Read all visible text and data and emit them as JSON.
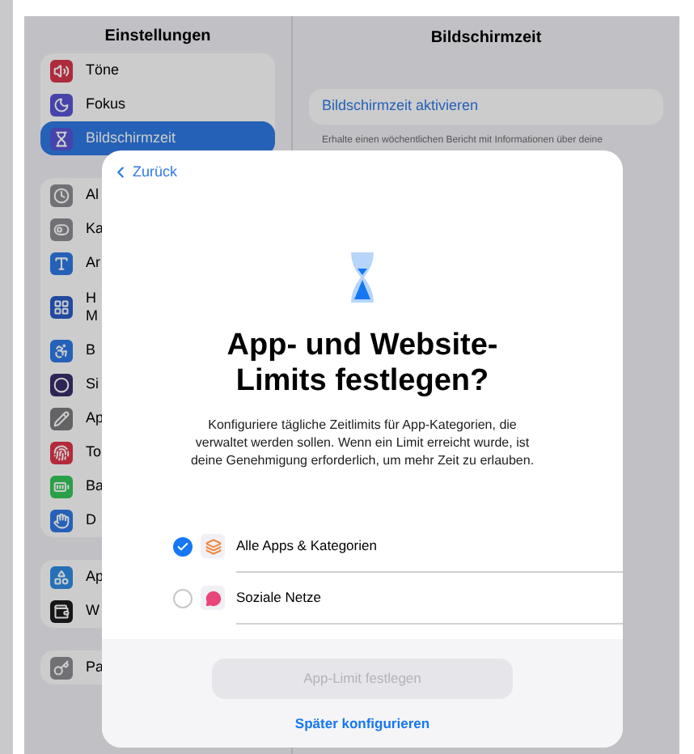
{
  "sidebar": {
    "title": "Einstellungen",
    "groups": [
      {
        "items": [
          {
            "label": "Töne",
            "selected": false
          },
          {
            "label": "Fokus",
            "selected": false
          },
          {
            "label": "Bildschirmzeit",
            "selected": true
          }
        ]
      },
      {
        "items": [
          {
            "label": "Al",
            "selected": false
          },
          {
            "label": "Ka",
            "selected": false
          },
          {
            "label": "Ar",
            "selected": false
          },
          {
            "label": "H\nM",
            "selected": false
          },
          {
            "label": "B",
            "selected": false
          },
          {
            "label": "Si",
            "selected": false
          },
          {
            "label": "Ap",
            "selected": false
          },
          {
            "label": "To",
            "selected": false
          },
          {
            "label": "Ba",
            "selected": false
          },
          {
            "label": "D",
            "selected": false
          }
        ]
      },
      {
        "items": [
          {
            "label": "Ap",
            "selected": false
          },
          {
            "label": "W",
            "selected": false
          }
        ]
      },
      {
        "items": [
          {
            "label": "Pa",
            "selected": false
          }
        ]
      }
    ]
  },
  "detail": {
    "title": "Bildschirmzeit",
    "action": "Bildschirmzeit aktivieren",
    "description": "Erhalte einen wöchentlichen Bericht mit Informationen über deine"
  },
  "sheet": {
    "back": "Zurück",
    "title": "App- und Website-Limits festlegen?",
    "text": "Konfiguriere tägliche Zeitlimits für App-Kategorien, die verwaltet werden sollen. Wenn ein Limit erreicht wurde, ist deine Genehmigung erforderlich, um mehr Zeit zu erlauben.",
    "options": [
      {
        "label": "Alle Apps & Kategorien",
        "checked": true
      },
      {
        "label": "Soziale Netze",
        "checked": false
      }
    ],
    "primary_button": {
      "label": "App-Limit festlegen",
      "disabled": true
    },
    "secondary_link": "Später konfigurieren"
  }
}
